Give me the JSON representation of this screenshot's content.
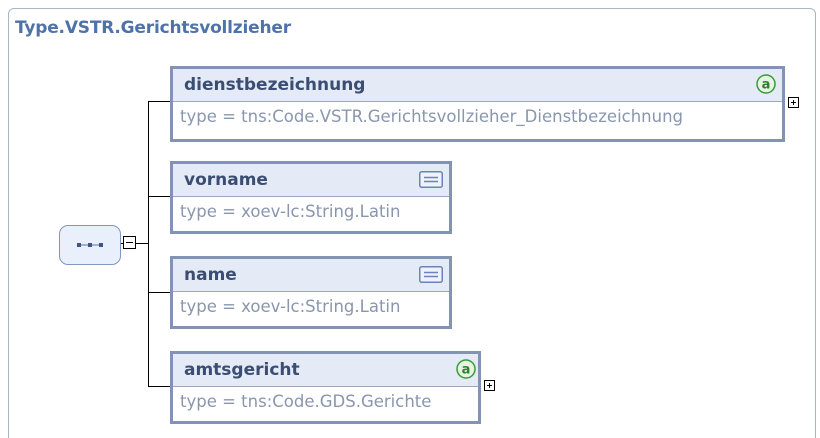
{
  "diagram": {
    "title": "Type.VSTR.Gerichtsvollzieher",
    "elements": [
      {
        "name": "dienstbezeichnung",
        "type": "type = tns:Code.VSTR.Gerichtsvollzieher_Dienstbezeichnung",
        "icon": "attribute-icon",
        "expandable": true
      },
      {
        "name": "vorname",
        "type": "type = xoev-lc:String.Latin",
        "icon": "documentation-icon",
        "expandable": false
      },
      {
        "name": "name",
        "type": "type = xoev-lc:String.Latin",
        "icon": "documentation-icon",
        "expandable": false
      },
      {
        "name": "amtsgericht",
        "type": "type = tns:Code.GDS.Gerichte",
        "icon": "attribute-icon",
        "expandable": true
      }
    ],
    "compositor": "sequence",
    "colors": {
      "title": "#4f72a8",
      "box_border": "#8393b3",
      "box_header": "#e4ebf6",
      "attribute_icon": "#3a9a3a"
    }
  }
}
